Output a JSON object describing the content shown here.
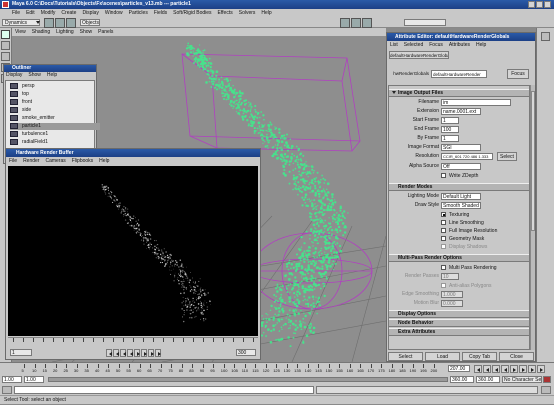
{
  "window": {
    "title": "Maya 6.0 C:\\Docs\\Tutorials\\Objects\\Fx\\scenes\\particles_v13.mb  ---  particle1",
    "menus": [
      "File",
      "Edit",
      "Modify",
      "Create",
      "Display",
      "Window",
      "Particles",
      "Fields",
      "Soft/Rigid Bodies",
      "Effects",
      "Solvers",
      "Help"
    ],
    "mode_dropdown": "Dynamics",
    "objects_label": "Objects"
  },
  "viewport": {
    "menus": [
      "View",
      "Shading",
      "Lighting",
      "Show",
      "Panels"
    ]
  },
  "outliner": {
    "title": "Outliner",
    "menus": [
      "Display",
      "Show",
      "Help"
    ],
    "items": [
      {
        "label": "persp",
        "selected": false
      },
      {
        "label": "top",
        "selected": false
      },
      {
        "label": "front",
        "selected": false
      },
      {
        "label": "side",
        "selected": false
      },
      {
        "label": "smoke_emitter",
        "selected": false
      },
      {
        "label": "particle1",
        "selected": true
      },
      {
        "label": "turbulence1",
        "selected": false
      },
      {
        "label": "radialField1",
        "selected": false
      }
    ]
  },
  "hw_buffer": {
    "title": "Hardware Render Buffer",
    "menus": [
      "File",
      "Render",
      "Cameras",
      "Flipbooks",
      "Help"
    ],
    "start_frame": "1",
    "end_frame": "300"
  },
  "attr_editor": {
    "title": "Attribute Editor: defaultHardwareRenderGlobals",
    "menus": [
      "List",
      "Selected",
      "Focus",
      "Attributes",
      "Help"
    ],
    "tab": "defaultHardwareRenderGlobals",
    "node_label": "hwRenderGlobals",
    "node_value": "defaultHardwareRender",
    "focus_button": "Focus",
    "sections": {
      "image_output": "Image Output Files",
      "render_modes": "Render Modes",
      "multipass": "Multi-Pass Render Options",
      "display_options": "Display Options",
      "node_behavior": "Node Behavior",
      "extra": "Extra Attributes"
    },
    "fields": {
      "filename_label": "Filename",
      "filename_value": "im",
      "extension_label": "Extension",
      "extension_value": "name.0001.ext",
      "start_label": "Start Frame",
      "start_value": "1",
      "end_label": "End Frame",
      "end_value": "100",
      "by_label": "By Frame",
      "by_value": "1",
      "format_label": "Image Format",
      "format_value": "SGI",
      "resolution_label": "Resolution",
      "resolution_value": "CCIR_601 720 486 1.333",
      "resolution_button": "Select",
      "alpha_label": "Alpha Source",
      "alpha_value": "Off",
      "write_zdepth": "Write ZDepth",
      "lighting_label": "Lighting Mode",
      "lighting_value": "Default Light",
      "draw_label": "Draw Style",
      "draw_value": "Smooth Shaded",
      "texturing": "Texturing",
      "line_smoothing": "Line Smoothing",
      "full_image_res": "Full Image Resolution",
      "geometry_mask": "Geometry Mask",
      "display_shadows": "Display Shadows",
      "multipass_rendering": "Multi Pass Rendering",
      "render_passes_label": "Render Passes",
      "render_passes_value": "10",
      "anti_alias": "Anti-alias Polygons",
      "edge_label": "Edge Smoothing",
      "edge_value": "1.000",
      "motion_label": "Motion Blur",
      "motion_value": "0.000"
    },
    "buttons": [
      "Select",
      "Load Attributes",
      "Copy Tab",
      "Close"
    ]
  },
  "timeline": {
    "ticks": [
      "5",
      "10",
      "15",
      "20",
      "25",
      "30",
      "35",
      "40",
      "45",
      "50",
      "55",
      "60",
      "65",
      "70",
      "75",
      "80",
      "85",
      "90",
      "95",
      "100",
      "105",
      "110",
      "115",
      "120",
      "125",
      "130",
      "135",
      "140",
      "145",
      "150",
      "155",
      "160",
      "165",
      "170",
      "175",
      "180",
      "185",
      "190",
      "195",
      "200"
    ],
    "current_frame": "207.00",
    "range_start": "1.00",
    "range_field": "1.00",
    "range_end": "360.00",
    "range_end2": "360.00",
    "character": "No Character Se"
  },
  "status": {
    "message": "Select Tool: select an object"
  },
  "colors": {
    "particles": "#3cf08c",
    "wire": "#b040c0",
    "title_blue": "#2a5aa8"
  }
}
